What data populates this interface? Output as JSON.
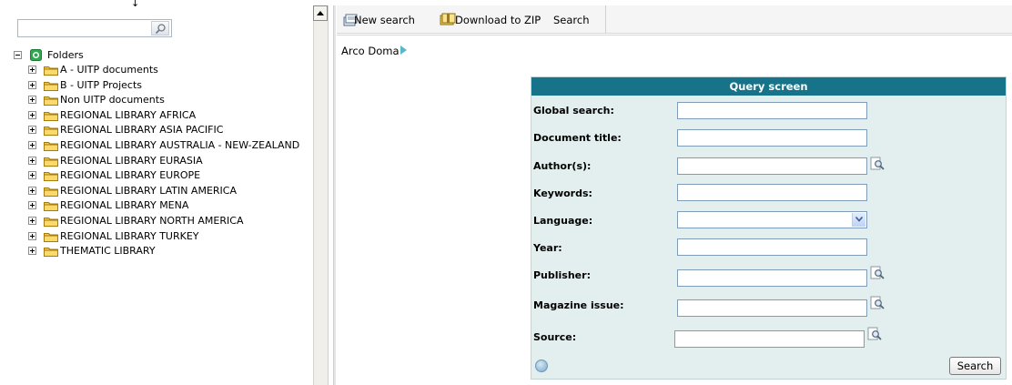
{
  "top_glyph": "↓",
  "tree": {
    "root_label": "Folders",
    "items": [
      {
        "label": "A - UITP documents"
      },
      {
        "label": "B - UITP Projects"
      },
      {
        "label": "Non UITP documents"
      },
      {
        "label": "REGIONAL LIBRARY AFRICA"
      },
      {
        "label": "REGIONAL LIBRARY ASIA PACIFIC"
      },
      {
        "label": "REGIONAL LIBRARY AUSTRALIA - NEW-ZEALAND"
      },
      {
        "label": "REGIONAL LIBRARY EURASIA"
      },
      {
        "label": "REGIONAL LIBRARY EUROPE"
      },
      {
        "label": "REGIONAL LIBRARY LATIN AMERICA"
      },
      {
        "label": "REGIONAL LIBRARY MENA"
      },
      {
        "label": "REGIONAL LIBRARY NORTH AMERICA"
      },
      {
        "label": "REGIONAL LIBRARY TURKEY"
      },
      {
        "label": "THEMATIC LIBRARY"
      }
    ]
  },
  "toolbar": {
    "new_search": "New search",
    "download_zip": "Download to ZIP",
    "search": "Search"
  },
  "breadcrumb": {
    "label": "Arco Doma"
  },
  "query": {
    "title": "Query screen",
    "fields": {
      "global_search": "Global search:",
      "document_title": "Document title:",
      "authors": "Author(s):",
      "keywords": "Keywords:",
      "language": "Language:",
      "year": "Year:",
      "publisher": "Publisher:",
      "magazine_issue": "Magazine issue:",
      "source": "Source:"
    },
    "submit_label": "Search"
  },
  "colors": {
    "panel_header": "#17738a",
    "panel_bg": "#e2efee",
    "folder": "#f5c542"
  }
}
